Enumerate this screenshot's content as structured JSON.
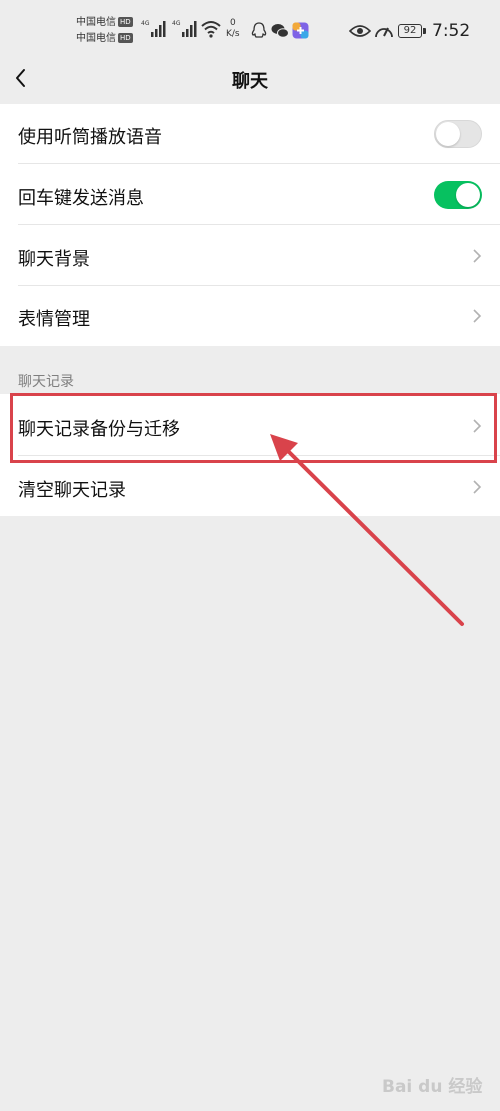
{
  "status_bar": {
    "carrier_1": "中国电信",
    "carrier_2": "中国电信",
    "hd_badge": "HD",
    "network_1": "4G",
    "network_2": "4G",
    "speed_value": "0",
    "speed_unit": "K/s",
    "battery": "92",
    "time": "7:52",
    "icons": [
      "signal-icon",
      "wifi-icon",
      "qq-icon",
      "wechat-icon",
      "app-icon",
      "eye-icon",
      "speedometer-icon",
      "battery-icon"
    ]
  },
  "nav": {
    "title": "聊天",
    "back_icon": "chevron-left-icon"
  },
  "settings": {
    "rows": [
      {
        "label": "使用听筒播放语音",
        "control": "toggle",
        "state": "off"
      },
      {
        "label": "回车键发送消息",
        "control": "toggle",
        "state": "on"
      },
      {
        "label": "聊天背景",
        "control": "chevron"
      },
      {
        "label": "表情管理",
        "control": "chevron"
      }
    ]
  },
  "history": {
    "section_title": "聊天记录",
    "rows": [
      {
        "label": "聊天记录备份与迁移",
        "control": "chevron",
        "highlighted": true
      },
      {
        "label": "清空聊天记录",
        "control": "chevron"
      }
    ]
  },
  "annotation": {
    "highlight_color": "#d9434b",
    "arrow_color": "#d9434b"
  },
  "watermark": "Bai du 经验",
  "colors": {
    "background": "#ededed",
    "toggle_on": "#07c160",
    "toggle_off": "#e5e5e5",
    "section_text": "#7f7f7f"
  }
}
